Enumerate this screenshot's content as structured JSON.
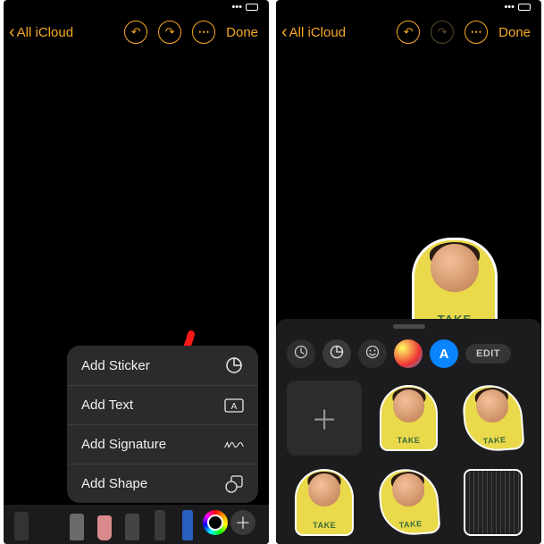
{
  "left": {
    "nav_back": "All iCloud",
    "done": "Done",
    "popup": {
      "items": [
        {
          "label": "Add Sticker",
          "icon": "sticker-outline-icon"
        },
        {
          "label": "Add Text",
          "icon": "text-box-icon"
        },
        {
          "label": "Add Signature",
          "icon": "signature-icon"
        },
        {
          "label": "Add Shape",
          "icon": "shapes-icon"
        }
      ]
    },
    "tools": [
      "pencil",
      "pen",
      "marker",
      "eraser",
      "lasso",
      "ruler",
      "brush"
    ]
  },
  "right": {
    "nav_back": "All iCloud",
    "done": "Done",
    "placed_sticker_caption": "TAKE",
    "drawer": {
      "tabs": {
        "recent": "recent",
        "sticker": "sticker",
        "emoji": "emoji",
        "memoji": "memoji",
        "appstore": "A",
        "edit": "EDIT"
      },
      "sticker_caption": "TAKE",
      "grid_count": 6
    }
  }
}
